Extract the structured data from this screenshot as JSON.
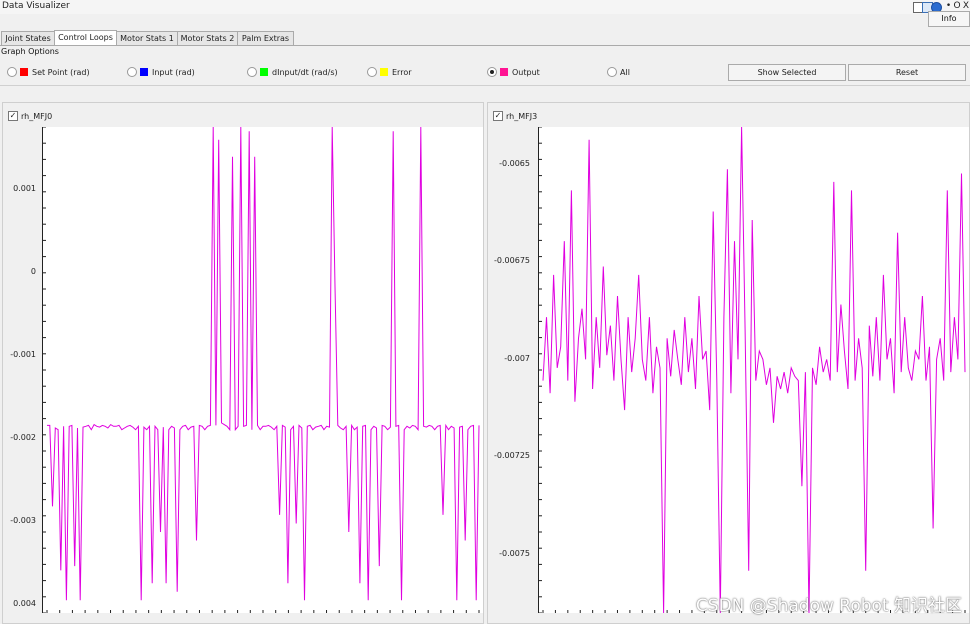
{
  "window": {
    "title": "Data Visualizer",
    "info_label": "Info",
    "ctrl_min": "•",
    "ctrl_max": "O",
    "ctrl_close": "X"
  },
  "tabs": [
    {
      "label": "Joint States",
      "active": false
    },
    {
      "label": "Control Loops",
      "active": true
    },
    {
      "label": "Motor Stats 1",
      "active": false
    },
    {
      "label": "Motor Stats 2",
      "active": false
    },
    {
      "label": "Palm Extras",
      "active": false
    }
  ],
  "graph_options": {
    "title": "Graph Options",
    "options": [
      {
        "label": "Set Point (rad)",
        "color": "#ff0000",
        "selected": false
      },
      {
        "label": "Input (rad)",
        "color": "#0000ff",
        "selected": false
      },
      {
        "label": "dInput/dt (rad/s)",
        "color": "#00ff00",
        "selected": false
      },
      {
        "label": "Error",
        "color": "#ffff00",
        "selected": false
      },
      {
        "label": "Output",
        "color": "#ff1493",
        "selected": true
      },
      {
        "label": "All",
        "color": null,
        "selected": false
      }
    ],
    "show_selected_label": "Show Selected",
    "reset_label": "Reset"
  },
  "plots": [
    {
      "name": "rh_MFJ0",
      "checked": true,
      "ticks": [
        "0.001",
        "0",
        "-0.001",
        "-0.002",
        "-0.003",
        "0.004"
      ]
    },
    {
      "name": "rh_MFJ3",
      "checked": true,
      "ticks": [
        "-0.0065",
        "-0.00675",
        "-0.007",
        "-0.00725",
        "-0.0075"
      ]
    }
  ],
  "chart_data": [
    {
      "type": "line",
      "title": "rh_MFJ0",
      "ylim": [
        -0.00405,
        0.00165
      ],
      "color": "#e000e0",
      "series": [
        {
          "values": [
            -0.00185,
            -0.00185,
            -0.0028,
            -0.00188,
            -0.0019,
            -0.00355,
            -0.00186,
            -0.0039,
            -0.00186,
            -0.00185,
            -0.0035,
            -0.00188,
            -0.0039,
            -0.00187,
            -0.00186,
            -0.00185,
            -0.0019,
            -0.00184,
            -0.00186,
            -0.00187,
            -0.00185,
            -0.00186,
            -0.00188,
            -0.00184,
            -0.00186,
            -0.00186,
            -0.00185,
            -0.0019,
            -0.00188,
            -0.00186,
            -0.00185,
            -0.00187,
            -0.0019,
            -0.00186,
            -0.0039,
            -0.00187,
            -0.0019,
            -0.00186,
            -0.0037,
            -0.00186,
            -0.0019,
            -0.0031,
            -0.00187,
            -0.0037,
            -0.0019,
            -0.00186,
            -0.00188,
            -0.0038,
            -0.0019,
            -0.00186,
            -0.00185,
            -0.0019,
            -0.00187,
            -0.00186,
            -0.0032,
            -0.00185,
            -0.00186,
            -0.0019,
            -0.00186,
            -0.00185,
            0.00165,
            -0.00185,
            0.0015,
            -0.00182,
            -0.00184,
            -0.00186,
            -0.0019,
            0.0013,
            -0.0019,
            -0.00186,
            0.00165,
            -0.00186,
            -0.00185,
            0.0016,
            -0.0019,
            0.0013,
            -0.00185,
            -0.0019,
            -0.00186,
            -0.00186,
            -0.00185,
            -0.00187,
            -0.0019,
            -0.00186,
            -0.0029,
            -0.00185,
            -0.00187,
            -0.0037,
            -0.0019,
            -0.00186,
            -0.003,
            -0.00185,
            -0.00188,
            -0.0039,
            -0.00186,
            -0.00185,
            -0.0019,
            -0.00187,
            -0.00186,
            -0.00185,
            -0.0019,
            -0.00186,
            -0.00187,
            0.00165,
            -0.00022,
            -0.00185,
            -0.00188,
            -0.0019,
            -0.00186,
            -0.0031,
            -0.00185,
            -0.0019,
            -0.00187,
            -0.0037,
            -0.00186,
            -0.00185,
            -0.0039,
            -0.0019,
            -0.00186,
            -0.00188,
            -0.0035,
            -0.00185,
            -0.00186,
            -0.0019,
            -0.00187,
            0.0016,
            -0.00186,
            -0.00185,
            -0.0039,
            -0.0019,
            -0.00186,
            -0.00188,
            -0.00185,
            -0.00186,
            -0.0019,
            0.00165,
            -0.00186,
            -0.00187,
            -0.00185,
            -0.00186,
            -0.0019,
            -0.00186,
            -0.00185,
            -0.0029,
            -0.00185,
            -0.0019,
            -0.00186,
            -0.00188,
            -0.0039,
            -0.00187,
            -0.00186,
            -0.0032,
            -0.0019,
            -0.00186,
            -0.00185,
            -0.0039,
            -0.00185
          ]
        }
      ]
    },
    {
      "type": "line",
      "title": "rh_MFJ3",
      "ylim": [
        -0.0076,
        -0.00645
      ],
      "color": "#e000e0",
      "series": [
        {
          "values": [
            -0.00705,
            -0.0069,
            -0.00708,
            -0.0068,
            -0.00702,
            -0.00697,
            -0.00672,
            -0.00705,
            -0.0066,
            -0.0071,
            -0.00695,
            -0.00688,
            -0.007,
            -0.00648,
            -0.00707,
            -0.0069,
            -0.00702,
            -0.00678,
            -0.00699,
            -0.00692,
            -0.00705,
            -0.00685,
            -0.007,
            -0.00712,
            -0.0069,
            -0.00703,
            -0.00695,
            -0.0068,
            -0.007,
            -0.00705,
            -0.0069,
            -0.00708,
            -0.00697,
            -0.00702,
            -0.0076,
            -0.00695,
            -0.00704,
            -0.00693,
            -0.007,
            -0.00706,
            -0.0069,
            -0.00703,
            -0.00695,
            -0.00707,
            -0.00685,
            -0.007,
            -0.00698,
            -0.00712,
            -0.00665,
            -0.00705,
            -0.0076,
            -0.0069,
            -0.00655,
            -0.00708,
            -0.00672,
            -0.007,
            -0.00645,
            -0.00693,
            -0.0075,
            -0.00667,
            -0.00705,
            -0.00698,
            -0.007,
            -0.00706,
            -0.00702,
            -0.00715,
            -0.00704,
            -0.00707,
            -0.00703,
            -0.00708,
            -0.00702,
            -0.00704,
            -0.00705,
            -0.0073,
            -0.00703,
            -0.0076,
            -0.00702,
            -0.00706,
            -0.00697,
            -0.00703,
            -0.007,
            -0.00705,
            -0.00658,
            -0.00703,
            -0.00687,
            -0.00698,
            -0.00707,
            -0.0066,
            -0.00705,
            -0.00695,
            -0.00702,
            -0.0075,
            -0.00692,
            -0.00704,
            -0.0069,
            -0.00705,
            -0.0068,
            -0.007,
            -0.00695,
            -0.00708,
            -0.0067,
            -0.00703,
            -0.0069,
            -0.00702,
            -0.00705,
            -0.00698,
            -0.007,
            -0.00685,
            -0.00705,
            -0.00697,
            -0.0074,
            -0.007,
            -0.00695,
            -0.00705,
            -0.0066,
            -0.00703,
            -0.0069,
            -0.007,
            -0.00656,
            -0.00703
          ]
        }
      ]
    }
  ]
}
